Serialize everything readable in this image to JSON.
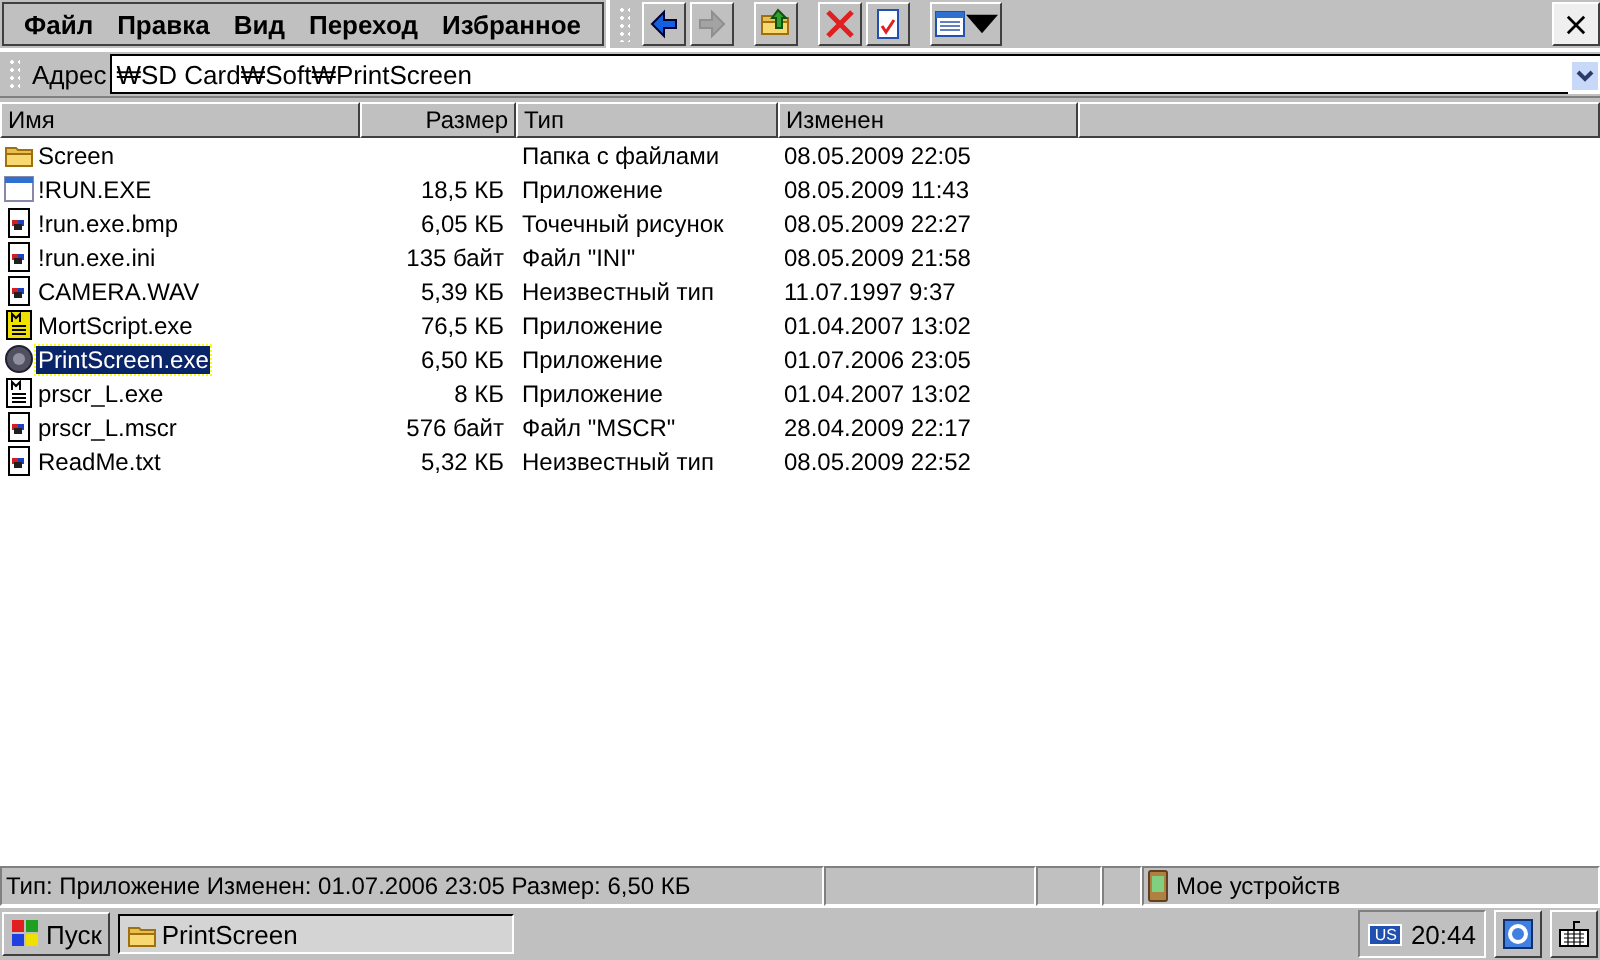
{
  "menu": [
    "Файл",
    "Правка",
    "Вид",
    "Переход",
    "Избранное"
  ],
  "toolbar": [
    {
      "kind": "back",
      "disabled": false
    },
    {
      "kind": "forward",
      "disabled": true
    },
    {
      "kind": "up",
      "disabled": false
    },
    {
      "kind": "delete",
      "disabled": false
    },
    {
      "kind": "properties",
      "disabled": false
    },
    {
      "kind": "view",
      "disabled": false
    }
  ],
  "address": {
    "label": "Адрес",
    "value": "₩SD Card₩Soft₩PrintScreen"
  },
  "columns": [
    "Имя",
    "Размер",
    "Тип",
    "Изменен"
  ],
  "rows": [
    {
      "kind": "folder",
      "name": "Screen",
      "type": "Папка с файлами",
      "modified": "08.05.2009 22:05",
      "selected": false
    },
    {
      "kind": "window",
      "name": "!RUN.EXE",
      "size": "18,5 КБ",
      "type": "Приложение",
      "modified": "08.05.2009 11:43",
      "selected": false
    },
    {
      "kind": "document",
      "name": "!run.exe.bmp",
      "size": "6,05 КБ",
      "type": "Точечный рисунок",
      "modified": "08.05.2009 22:27",
      "selected": false
    },
    {
      "kind": "document",
      "name": "!run.exe.ini",
      "size": "135 байт",
      "type": "Файл \"INI\"",
      "modified": "08.05.2009 21:58",
      "selected": false
    },
    {
      "kind": "document",
      "name": "CAMERA.WAV",
      "size": "5,39 КБ",
      "type": "Неизвестный тип",
      "modified": "11.07.1997 9:37",
      "selected": false
    },
    {
      "kind": "script",
      "name": "MortScript.exe",
      "size": "76,5 КБ",
      "type": "Приложение",
      "modified": "01.04.2007 13:02",
      "selected": false
    },
    {
      "kind": "checker",
      "name": "PrintScreen.exe",
      "size": "6,50 КБ",
      "type": "Приложение",
      "modified": "01.07.2006 23:05",
      "selected": true
    },
    {
      "kind": "script-plain",
      "name": "prscr_L.exe",
      "size": "8 КБ",
      "type": "Приложение",
      "modified": "01.04.2007 13:02",
      "selected": false
    },
    {
      "kind": "document",
      "name": "prscr_L.mscr",
      "size": "576 байт",
      "type": "Файл \"MSCR\"",
      "modified": "28.04.2009 22:17",
      "selected": false
    },
    {
      "kind": "document",
      "name": "ReadMe.txt",
      "size": "5,32 КБ",
      "type": "Неизвестный тип",
      "modified": "08.05.2009 22:52",
      "selected": false
    }
  ],
  "status_bar": {
    "text": "Тип: Приложение Изменен: 01.07.2006 23:05 Размер: 6,50 КБ",
    "device": "Мое устройств"
  },
  "taskbar": {
    "start": "Пуск",
    "tasks": [
      {
        "label": "PrintScreen",
        "selected": true
      }
    ],
    "lang": "US",
    "clock": "20:44"
  }
}
